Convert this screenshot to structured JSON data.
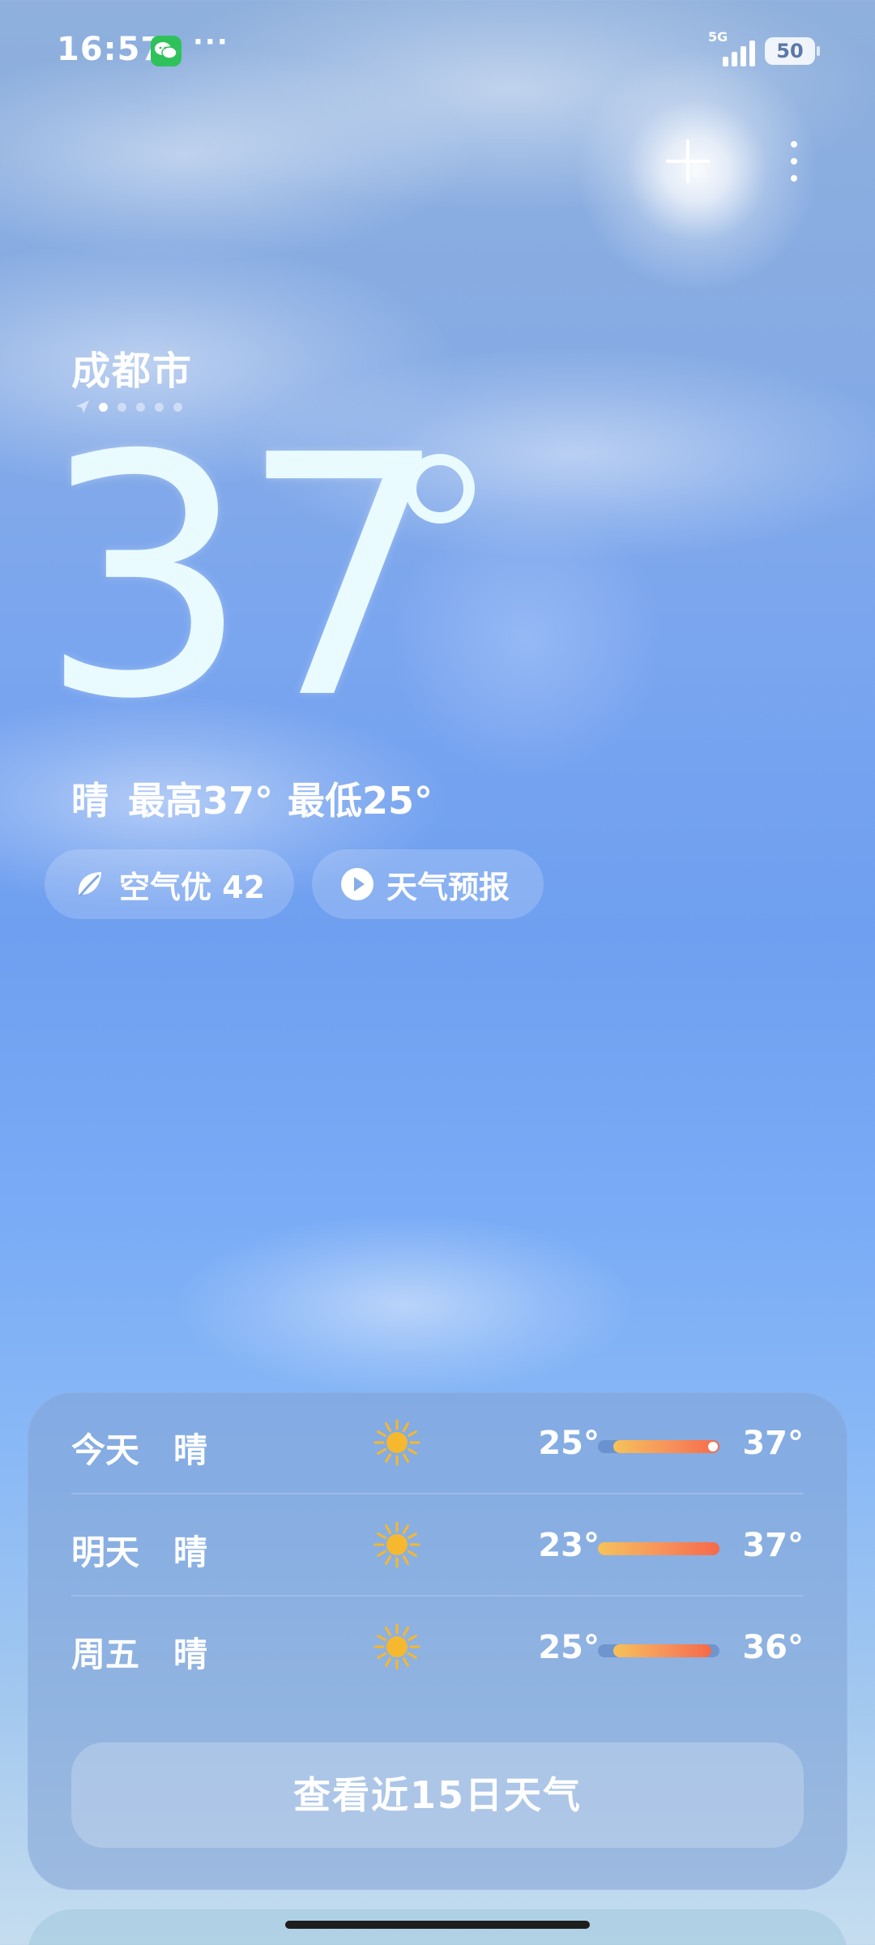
{
  "status_bar": {
    "time": "16:57",
    "more_notifications": "···",
    "network": "5G",
    "battery": "50"
  },
  "location": {
    "city": "成都市",
    "page_count": 5,
    "active_page": 1
  },
  "current": {
    "temperature": "37",
    "summary_condition": "晴",
    "summary_high": "最高37°",
    "summary_low": "最低25°"
  },
  "pills": {
    "air_quality": "空气优 42",
    "weather_forecast": "天气预报"
  },
  "forecast": {
    "scale_min": 23,
    "scale_max": 37,
    "days": [
      {
        "day": "今天",
        "condition": "晴",
        "icon": "sun-icon",
        "low": "25°",
        "high": "37°",
        "low_value": 25,
        "high_value": 37,
        "current_value": 37
      },
      {
        "day": "明天",
        "condition": "晴",
        "icon": "sun-icon",
        "low": "23°",
        "high": "37°",
        "low_value": 23,
        "high_value": 37
      },
      {
        "day": "周五",
        "condition": "晴",
        "icon": "sun-icon",
        "low": "25°",
        "high": "36°",
        "low_value": 25,
        "high_value": 36
      }
    ],
    "more_button": "查看近15日天气"
  },
  "colors": {
    "bar_track": "#5078be",
    "bar_warm": "#f7905a",
    "sun": "#f5b82e"
  }
}
